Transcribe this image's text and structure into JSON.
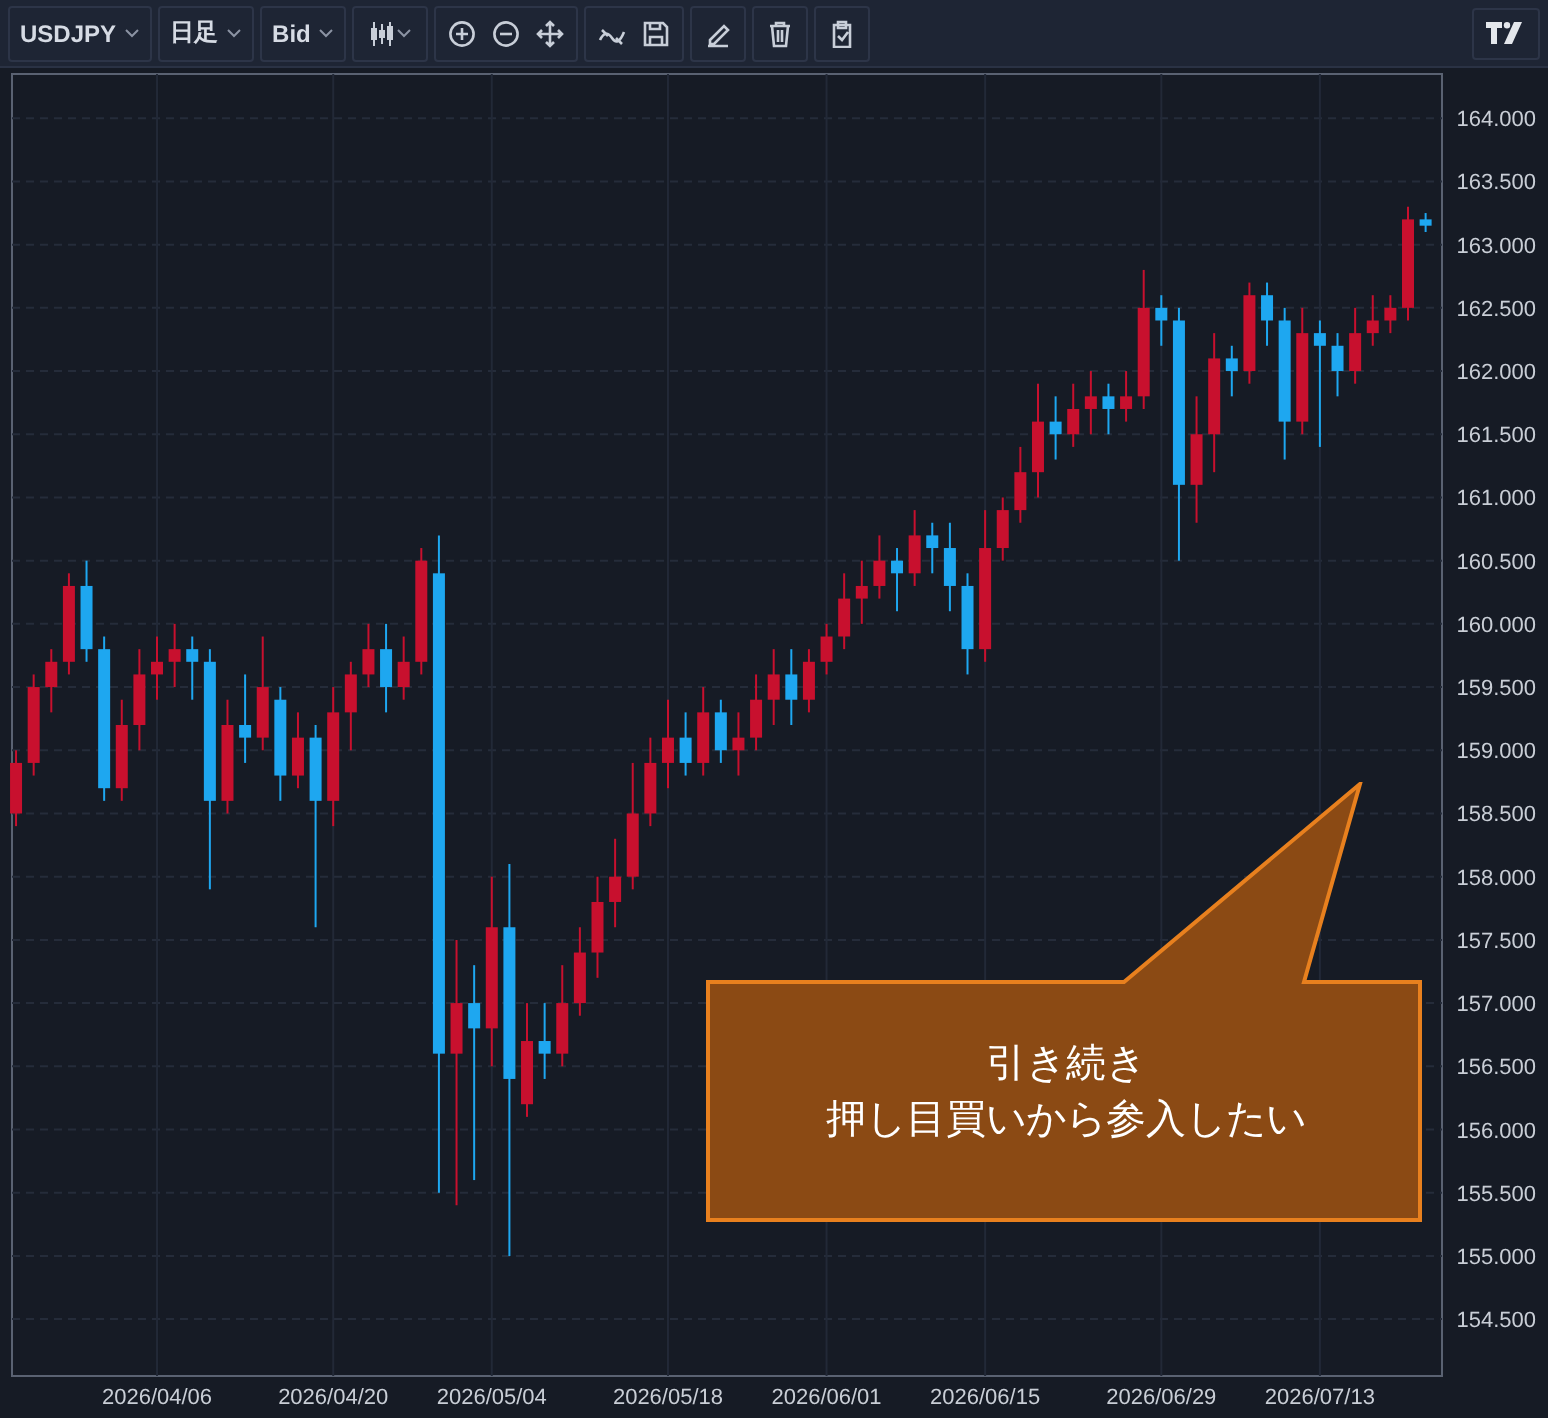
{
  "toolbar": {
    "symbol": "USDJPY",
    "interval": "日足",
    "price_side": "Bid"
  },
  "chart": {
    "chart_data": {
      "type": "candlestick",
      "categories": [
        null,
        null,
        null,
        null,
        null,
        null,
        null,
        null,
        "2026/04/06",
        null,
        null,
        null,
        null,
        null,
        null,
        null,
        null,
        null,
        "2026/04/20",
        null,
        null,
        null,
        null,
        null,
        null,
        null,
        null,
        "2026/05/04",
        null,
        null,
        null,
        null,
        null,
        null,
        null,
        null,
        null,
        "2026/05/18",
        null,
        null,
        null,
        null,
        null,
        null,
        null,
        null,
        "2026/06/01",
        null,
        null,
        null,
        null,
        null,
        null,
        null,
        null,
        "2026/06/15",
        null,
        null,
        null,
        null,
        null,
        null,
        null,
        null,
        null,
        "2026/06/29",
        null,
        null,
        null,
        null,
        null,
        null,
        null,
        null,
        "2026/07/13",
        null,
        null,
        null,
        null,
        null,
        null
      ],
      "ohlc": [
        [
          158.5,
          159.0,
          158.4,
          158.9
        ],
        [
          158.9,
          159.6,
          158.8,
          159.5
        ],
        [
          159.5,
          159.8,
          159.3,
          159.7
        ],
        [
          159.7,
          160.4,
          159.6,
          160.3
        ],
        [
          160.3,
          160.5,
          159.7,
          159.8
        ],
        [
          159.8,
          159.9,
          158.6,
          158.7
        ],
        [
          158.7,
          159.4,
          158.6,
          159.2
        ],
        [
          159.2,
          159.8,
          159.0,
          159.6
        ],
        [
          159.6,
          159.9,
          159.4,
          159.7
        ],
        [
          159.7,
          160.0,
          159.5,
          159.8
        ],
        [
          159.8,
          159.9,
          159.4,
          159.7
        ],
        [
          159.7,
          159.8,
          157.9,
          158.6
        ],
        [
          158.6,
          159.4,
          158.5,
          159.2
        ],
        [
          159.2,
          159.6,
          158.9,
          159.1
        ],
        [
          159.1,
          159.9,
          159.0,
          159.5
        ],
        [
          159.4,
          159.5,
          158.6,
          158.8
        ],
        [
          158.8,
          159.3,
          158.7,
          159.1
        ],
        [
          159.1,
          159.2,
          157.6,
          158.6
        ],
        [
          158.6,
          159.5,
          158.4,
          159.3
        ],
        [
          159.3,
          159.7,
          159.0,
          159.6
        ],
        [
          159.6,
          160.0,
          159.5,
          159.8
        ],
        [
          159.8,
          160.0,
          159.3,
          159.5
        ],
        [
          159.5,
          159.9,
          159.4,
          159.7
        ],
        [
          159.7,
          160.6,
          159.6,
          160.5
        ],
        [
          160.4,
          160.7,
          155.5,
          156.6
        ],
        [
          156.6,
          157.5,
          155.4,
          157.0
        ],
        [
          157.0,
          157.3,
          155.6,
          156.8
        ],
        [
          156.8,
          158.0,
          156.5,
          157.6
        ],
        [
          157.6,
          158.1,
          155.0,
          156.4
        ],
        [
          156.2,
          157.0,
          156.1,
          156.7
        ],
        [
          156.7,
          157.0,
          156.4,
          156.6
        ],
        [
          156.6,
          157.3,
          156.5,
          157.0
        ],
        [
          157.0,
          157.6,
          156.9,
          157.4
        ],
        [
          157.4,
          158.0,
          157.2,
          157.8
        ],
        [
          157.8,
          158.3,
          157.6,
          158.0
        ],
        [
          158.0,
          158.9,
          157.9,
          158.5
        ],
        [
          158.5,
          159.1,
          158.4,
          158.9
        ],
        [
          158.9,
          159.4,
          158.7,
          159.1
        ],
        [
          159.1,
          159.3,
          158.8,
          158.9
        ],
        [
          158.9,
          159.5,
          158.8,
          159.3
        ],
        [
          159.3,
          159.4,
          158.9,
          159.0
        ],
        [
          159.0,
          159.3,
          158.8,
          159.1
        ],
        [
          159.1,
          159.6,
          159.0,
          159.4
        ],
        [
          159.4,
          159.8,
          159.2,
          159.6
        ],
        [
          159.6,
          159.8,
          159.2,
          159.4
        ],
        [
          159.4,
          159.8,
          159.3,
          159.7
        ],
        [
          159.7,
          160.0,
          159.6,
          159.9
        ],
        [
          159.9,
          160.4,
          159.8,
          160.2
        ],
        [
          160.2,
          160.5,
          160.0,
          160.3
        ],
        [
          160.3,
          160.7,
          160.2,
          160.5
        ],
        [
          160.5,
          160.6,
          160.1,
          160.4
        ],
        [
          160.4,
          160.9,
          160.3,
          160.7
        ],
        [
          160.7,
          160.8,
          160.4,
          160.6
        ],
        [
          160.6,
          160.8,
          160.1,
          160.3
        ],
        [
          160.3,
          160.4,
          159.6,
          159.8
        ],
        [
          159.8,
          160.9,
          159.7,
          160.6
        ],
        [
          160.6,
          161.0,
          160.5,
          160.9
        ],
        [
          160.9,
          161.4,
          160.8,
          161.2
        ],
        [
          161.2,
          161.9,
          161.0,
          161.6
        ],
        [
          161.6,
          161.8,
          161.3,
          161.5
        ],
        [
          161.5,
          161.9,
          161.4,
          161.7
        ],
        [
          161.7,
          162.0,
          161.5,
          161.8
        ],
        [
          161.8,
          161.9,
          161.5,
          161.7
        ],
        [
          161.7,
          162.0,
          161.6,
          161.8
        ],
        [
          161.8,
          162.8,
          161.7,
          162.5
        ],
        [
          162.5,
          162.6,
          162.2,
          162.4
        ],
        [
          162.4,
          162.5,
          160.5,
          161.1
        ],
        [
          161.1,
          161.8,
          160.8,
          161.5
        ],
        [
          161.5,
          162.3,
          161.2,
          162.1
        ],
        [
          162.1,
          162.2,
          161.8,
          162.0
        ],
        [
          162.0,
          162.7,
          161.9,
          162.6
        ],
        [
          162.6,
          162.7,
          162.2,
          162.4
        ],
        [
          162.4,
          162.5,
          161.3,
          161.6
        ],
        [
          161.6,
          162.5,
          161.5,
          162.3
        ],
        [
          162.3,
          162.4,
          161.4,
          162.2
        ],
        [
          162.2,
          162.3,
          161.8,
          162.0
        ],
        [
          162.0,
          162.5,
          161.9,
          162.3
        ],
        [
          162.3,
          162.6,
          162.2,
          162.4
        ],
        [
          162.4,
          162.6,
          162.3,
          162.5
        ],
        [
          162.5,
          163.3,
          162.4,
          163.2
        ],
        [
          163.2,
          163.25,
          163.1,
          163.15
        ]
      ],
      "ylim": [
        154.05,
        164.35
      ],
      "yticks": [
        {
          "value": 164,
          "label": "164.000"
        },
        {
          "value": 163.5,
          "label": "163.500"
        },
        {
          "value": 163,
          "label": "163.000"
        },
        {
          "value": 162.5,
          "label": "162.500"
        },
        {
          "value": 162,
          "label": "162.000"
        },
        {
          "value": 161.5,
          "label": "161.500"
        },
        {
          "value": 161,
          "label": "161.000"
        },
        {
          "value": 160.5,
          "label": "160.500"
        },
        {
          "value": 160,
          "label": "160.000"
        },
        {
          "value": 159.5,
          "label": "159.500"
        },
        {
          "value": 159,
          "label": "159.000"
        },
        {
          "value": 158.5,
          "label": "158.500"
        },
        {
          "value": 158,
          "label": "158.000"
        },
        {
          "value": 157.5,
          "label": "157.500"
        },
        {
          "value": 157,
          "label": "157.000"
        },
        {
          "value": 156.5,
          "label": "156.500"
        },
        {
          "value": 156,
          "label": "156.000"
        },
        {
          "value": 155.5,
          "label": "155.500"
        },
        {
          "value": 155,
          "label": "155.000"
        },
        {
          "value": 154.5,
          "label": "154.500"
        }
      ],
      "grid": true
    }
  },
  "callout": {
    "lines": [
      "引き続き",
      "押し目買いから参入したい"
    ]
  }
}
